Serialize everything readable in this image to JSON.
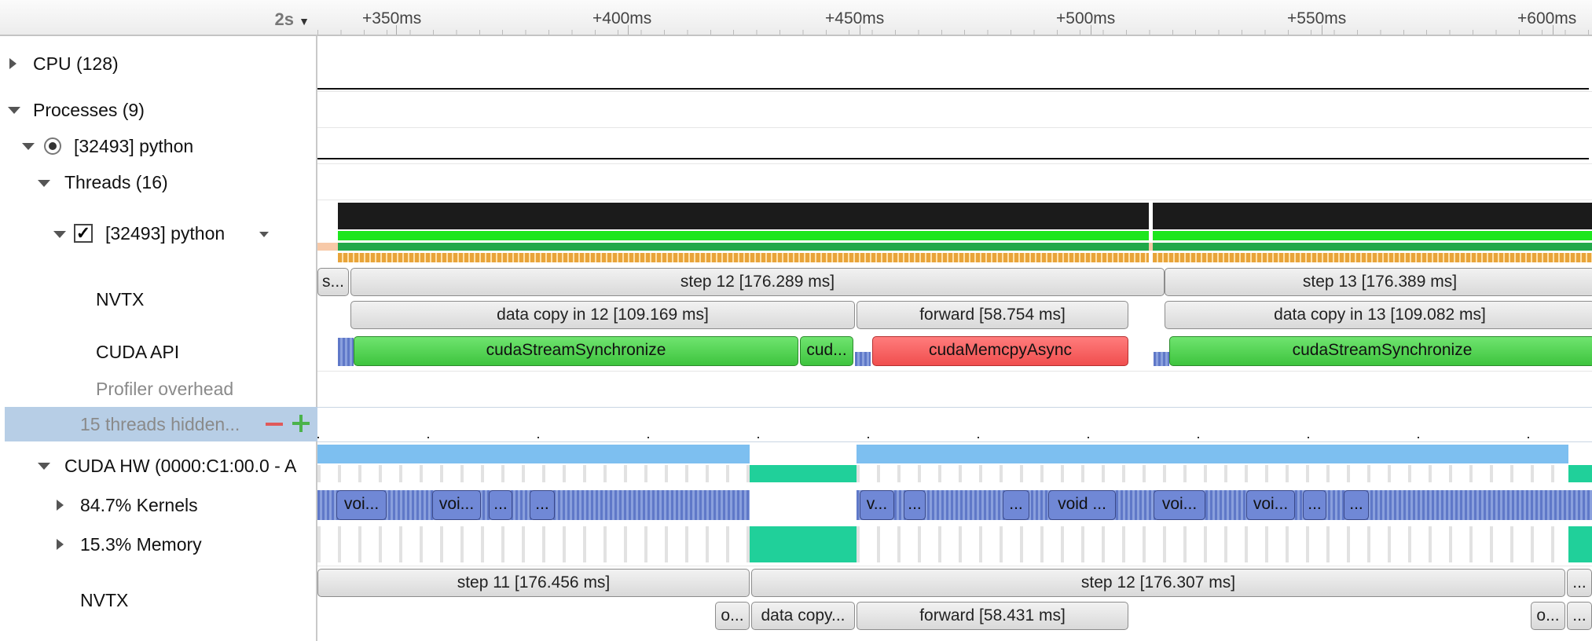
{
  "ruler": {
    "range": "2s",
    "ticks": [
      "+350ms",
      "+400ms",
      "+450ms",
      "+500ms",
      "+550ms",
      "+600ms"
    ]
  },
  "tree": {
    "cpu": "CPU (128)",
    "processes": "Processes (9)",
    "process": "[32493] python",
    "threads": "Threads (16)",
    "thread": "[32493] python",
    "nvtx": "NVTX",
    "cuda_api": "CUDA API",
    "profiler_overhead": "Profiler overhead",
    "hidden_threads": "15 threads hidden...",
    "cuda_hw": "CUDA HW (0000:C1:00.0 - A",
    "kernels": "84.7% Kernels",
    "memory": "15.3% Memory",
    "nvtx_hw": "NVTX"
  },
  "timeline": {
    "nvtx_top": [
      "s...",
      "step 12 [176.289 ms]",
      "step 13 [176.389 ms]"
    ],
    "nvtx_sub": [
      "data copy in 12 [109.169 ms]",
      "forward [58.754 ms]",
      "data copy in 13 [109.082 ms]"
    ],
    "cuda_api": [
      "cudaStreamSynchronize",
      "cud...",
      "cudaMemcpyAsync",
      "cudaStreamSynchronize"
    ],
    "kernels_labels": [
      "voi...",
      "voi...",
      "...",
      "...",
      "v...",
      "...",
      "...",
      "void ...",
      "voi...",
      "voi...",
      "...",
      "..."
    ],
    "nvtx_hw_top": [
      "step 11 [176.456 ms]",
      "step 12 [176.307 ms]",
      "..."
    ],
    "nvtx_hw_sub": [
      "o...",
      "data copy...",
      "forward [58.431 ms]",
      "o...",
      "..."
    ]
  },
  "colors": {
    "api_sync": "#4fd34f",
    "api_memcpy": "#f25a5a",
    "kernel": "#7088d6",
    "memory": "#20d09a",
    "mem_util": "#7dbff0",
    "selection": "#b7cee6"
  }
}
